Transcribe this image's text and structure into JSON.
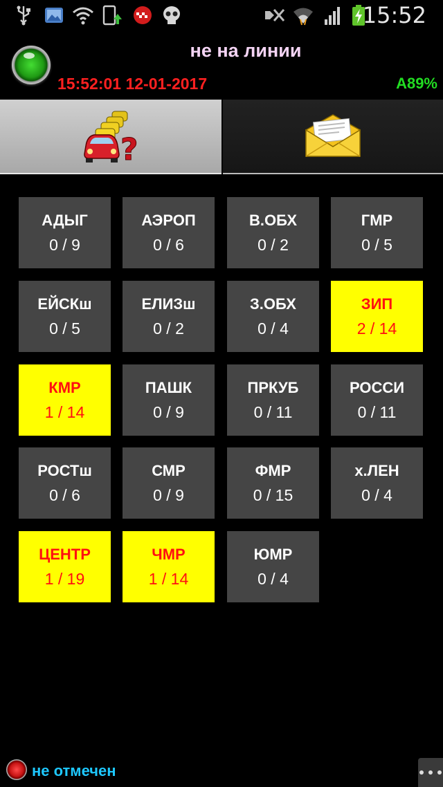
{
  "status_bar": {
    "time": "15:52",
    "icons": [
      "usb-icon",
      "gallery-icon",
      "wifi-question-icon",
      "phone-sync-icon",
      "taxi-badge-icon",
      "skull-icon",
      "mute-icon",
      "wifi-icon",
      "signal-icon",
      "battery-charging-icon"
    ]
  },
  "header": {
    "connection_status": "не на линии",
    "datetime": "15:52:01 12-01-2017",
    "battery": "А89%",
    "colors": {
      "status": "#f4d4f4",
      "datetime": "#ff2020",
      "battery": "#22dd22"
    }
  },
  "tabs": [
    {
      "name": "queue",
      "icon": "cars-queue-icon",
      "active": true
    },
    {
      "name": "messages",
      "icon": "envelope-icon",
      "active": false
    }
  ],
  "zones": [
    {
      "name": "АДЫГ",
      "count": "0 / 9",
      "highlight": false
    },
    {
      "name": "АЭРОП",
      "count": "0 / 6",
      "highlight": false
    },
    {
      "name": "В.ОБХ",
      "count": "0 / 2",
      "highlight": false
    },
    {
      "name": "ГМР",
      "count": "0 / 5",
      "highlight": false
    },
    {
      "name": "ЕЙСКш",
      "count": "0 / 5",
      "highlight": false
    },
    {
      "name": "ЕЛИЗш",
      "count": "0 / 2",
      "highlight": false
    },
    {
      "name": "З.ОБХ",
      "count": "0 / 4",
      "highlight": false
    },
    {
      "name": "ЗИП",
      "count": "2 / 14",
      "highlight": true
    },
    {
      "name": "КМР",
      "count": "1 / 14",
      "highlight": true
    },
    {
      "name": "ПАШК",
      "count": "0 / 9",
      "highlight": false
    },
    {
      "name": "ПРКУБ",
      "count": "0 / 11",
      "highlight": false
    },
    {
      "name": "РОССИ",
      "count": "0 / 11",
      "highlight": false
    },
    {
      "name": "РОСТш",
      "count": "0 / 6",
      "highlight": false
    },
    {
      "name": "СМР",
      "count": "0 / 9",
      "highlight": false
    },
    {
      "name": "ФМР",
      "count": "0 / 15",
      "highlight": false
    },
    {
      "name": "х.ЛЕН",
      "count": "0 / 4",
      "highlight": false
    },
    {
      "name": "ЦЕНТР",
      "count": "1 / 19",
      "highlight": true
    },
    {
      "name": "ЧМР",
      "count": "1 / 14",
      "highlight": true
    },
    {
      "name": "ЮМР",
      "count": "0 / 4",
      "highlight": false
    }
  ],
  "footer": {
    "mark_status": "не отмечен",
    "colors": {
      "text": "#1ec8ff"
    }
  }
}
